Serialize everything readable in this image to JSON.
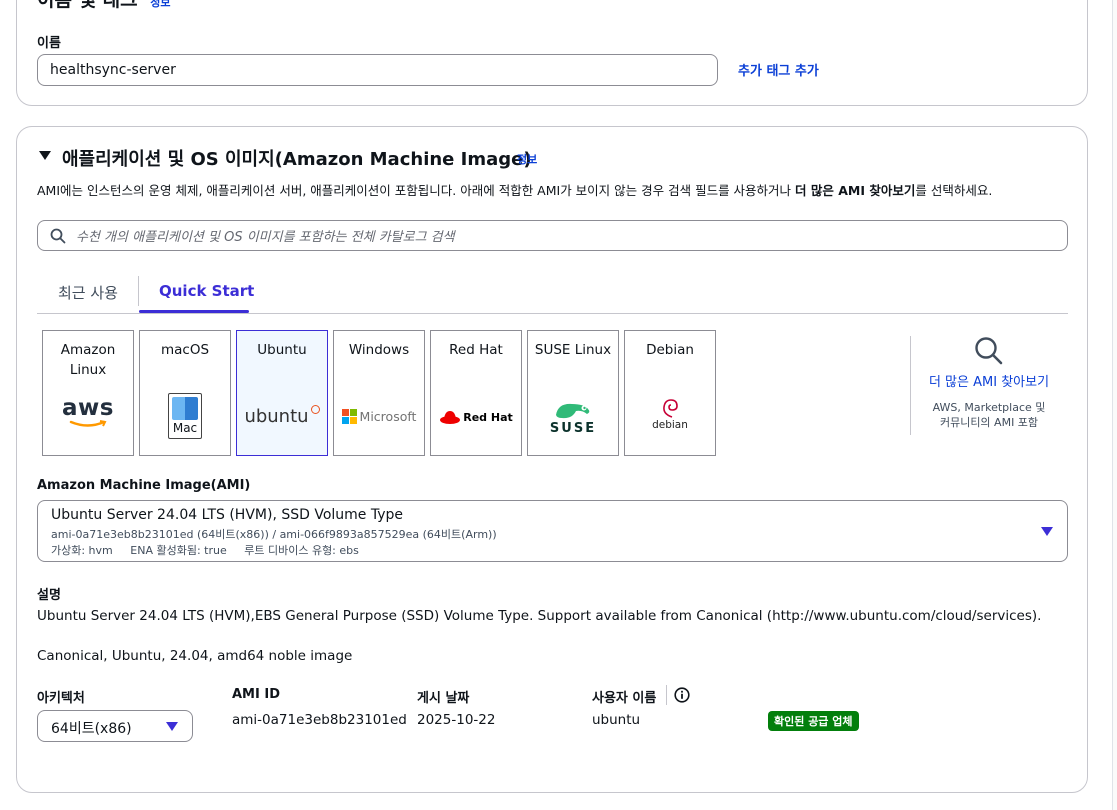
{
  "name_tags": {
    "section_title": "이름 및 태그",
    "info": "정보",
    "name_label": "이름",
    "name_value": "healthsync-server",
    "add_tags_link": "추가 태그 추가"
  },
  "ami_section": {
    "title": "애플리케이션 및 OS 이미지(Amazon Machine Image)",
    "info": "정보",
    "description_prefix": "AMI에는 인스턴스의 운영 체제, 애플리케이션 서버, 애플리케이션이 포함됩니다. 아래에 적합한 AMI가 보이지 않는 경우 검색 필드를 사용하거나 ",
    "description_bold": "더 많은 AMI 찾아보기",
    "description_suffix": "를 선택하세요.",
    "search_placeholder": "수천 개의 애플리케이션 및 OS 이미지를 포함하는 전체 카탈로그 검색",
    "tabs": [
      {
        "label": "최근 사용",
        "active": false
      },
      {
        "label": "Quick Start",
        "active": true
      }
    ],
    "os_cards": [
      {
        "label": "Amazon Linux",
        "logo": "aws-logo",
        "selected": false
      },
      {
        "label": "macOS",
        "logo": "mac-logo",
        "selected": false
      },
      {
        "label": "Ubuntu",
        "logo": "ubuntu-logo",
        "selected": true
      },
      {
        "label": "Windows",
        "logo": "microsoft-logo",
        "selected": false
      },
      {
        "label": "Red Hat",
        "logo": "redhat-logo",
        "selected": false
      },
      {
        "label": "SUSE Linux",
        "logo": "suse-logo",
        "selected": false
      },
      {
        "label": "Debian",
        "logo": "debian-logo",
        "selected": false
      }
    ],
    "logo_texts": {
      "aws": "aws",
      "mac": "Mac",
      "ubuntu": "ubuntu",
      "microsoft": "Microsoft",
      "redhat": "Red Hat",
      "suse": "SUSE",
      "debian": "debian"
    },
    "browse_more": {
      "label": "더 많은 AMI 찾아보기",
      "sub_line1": "AWS, Marketplace 및",
      "sub_line2": "커뮤니티의 AMI 포함"
    },
    "ami_label": "Amazon Machine Image(AMI)",
    "ami_select": {
      "title": "Ubuntu Server 24.04 LTS (HVM), SSD Volume Type",
      "ids": "ami-0a71e3eb8b23101ed (64비트(x86)) / ami-066f9893a857529ea (64비트(Arm))",
      "virtualization": "가상화: hvm",
      "ena": "ENA 활성화됨: true",
      "root_device": "루트 디바이스 유형: ebs"
    },
    "description_label": "설명",
    "description_text": "Ubuntu Server 24.04 LTS (HVM),EBS General Purpose (SSD) Volume Type. Support available from Canonical (http://www.ubuntu.com/cloud/services).",
    "description_text2": "Canonical, Ubuntu, 24.04, amd64 noble image",
    "architecture_label": "아키텍처",
    "architecture_value": "64비트(x86)",
    "ami_id_label": "AMI ID",
    "ami_id_value": "ami-0a71e3eb8b23101ed",
    "publish_date_label": "게시 날짜",
    "publish_date_value": "2025-10-22",
    "username_label": "사용자 이름",
    "username_value": "ubuntu",
    "verified_badge": "확인된 공급 업체"
  },
  "colors": {
    "accent": "#3c2ed6",
    "link": "#0b3fd6",
    "badge_green": "#037f0c"
  }
}
